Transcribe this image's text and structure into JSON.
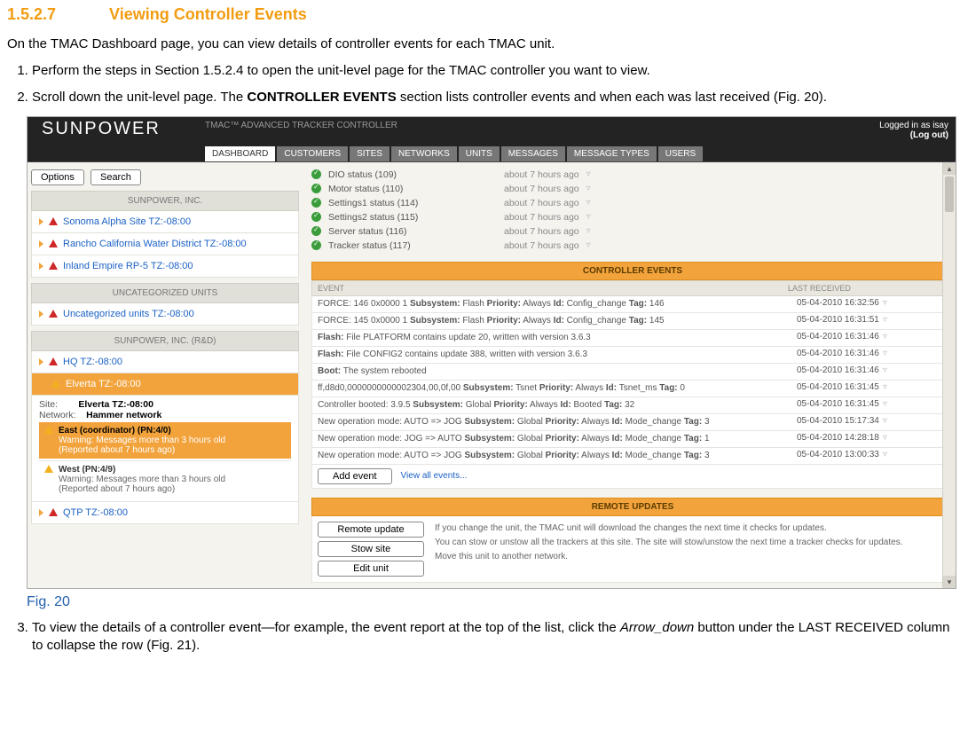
{
  "heading": {
    "num": "1.5.2.7",
    "title": "Viewing Controller Events"
  },
  "intro": "On the TMAC Dashboard page, you can view details of controller events for each TMAC unit.",
  "step1": "Perform the steps in Section 1.5.2.4 to open the unit-level page for the TMAC controller you want to view.",
  "step2_a": "Scroll down the unit-level page. The ",
  "step2_b": "CONTROLLER EVENTS",
  "step2_c": " section lists controller events and when each was last received (Fig. 20).",
  "fig_caption": "Fig. 20",
  "step3_a": "To view the details of a controller event—for example, the event report at the top of the list, click the ",
  "step3_i": "Arrow_down",
  "step3_b": " button under the LAST RECEIVED column to collapse the row (Fig. 21).",
  "logo": "SUNPOWER",
  "crumb": "TMAC™ ADVANCED TRACKER CONTROLLER",
  "login_as": "Logged in as isay",
  "logout": "(Log out)",
  "tabs": [
    "DASHBOARD",
    "CUSTOMERS",
    "SITES",
    "NETWORKS",
    "UNITS",
    "MESSAGES",
    "MESSAGE TYPES",
    "USERS"
  ],
  "side": {
    "options": "Options",
    "search": "Search",
    "grp1": "SUNPOWER, INC.",
    "items1": [
      "Sonoma Alpha Site TZ:-08:00",
      "Rancho California Water District TZ:-08:00",
      "Inland Empire RP-5 TZ:-08:00"
    ],
    "grp2": "UNCATEGORIZED UNITS",
    "items2": [
      "Uncategorized units TZ:-08:00"
    ],
    "grp3": "SUNPOWER, INC. (R&D)",
    "items3": [
      "HQ TZ:-08:00"
    ],
    "sel": "Elverta TZ:-08:00",
    "site_lbl": "Site:",
    "site_val": "Elverta TZ:-08:00",
    "net_lbl": "Network:",
    "net_val": "Hammer network",
    "east_title": "East (coordinator) (PN:4/0)",
    "east_warn1": "Warning: Messages more than 3 hours old",
    "east_warn2": "(Reported about 7 hours ago)",
    "west_title": "West (PN:4/9)",
    "west_warn1": "Warning: Messages more than 3 hours old",
    "west_warn2": "(Reported about 7 hours ago)",
    "qtp": "QTP TZ:-08:00"
  },
  "status": [
    {
      "label": "DIO status (109)",
      "ago": "about 7 hours ago"
    },
    {
      "label": "Motor status (110)",
      "ago": "about 7 hours ago"
    },
    {
      "label": "Settings1 status (114)",
      "ago": "about 7 hours ago"
    },
    {
      "label": "Settings2 status (115)",
      "ago": "about 7 hours ago"
    },
    {
      "label": "Server status (116)",
      "ago": "about 7 hours ago"
    },
    {
      "label": "Tracker status (117)",
      "ago": "about 7 hours ago"
    }
  ],
  "events_head": "CONTROLLER EVENTS",
  "ev_col1": "EVENT",
  "ev_col2": "LAST RECEIVED",
  "events": [
    {
      "t": "FORCE: 146 0x0000 1 <b>Subsystem:</b> Flash <b>Priority:</b> Always <b>Id:</b> Config_change <b>Tag:</b> 146",
      "d": "05-04-2010 16:32:56"
    },
    {
      "t": "FORCE: 145 0x0000 1 <b>Subsystem:</b> Flash <b>Priority:</b> Always <b>Id:</b> Config_change <b>Tag:</b> 145",
      "d": "05-04-2010 16:31:51"
    },
    {
      "t": "<b>Flash:</b> File PLATFORM contains update 20, written with version 3.6.3",
      "d": "05-04-2010 16:31:46"
    },
    {
      "t": "<b>Flash:</b> File CONFIG2 contains update 388, written with version 3.6.3",
      "d": "05-04-2010 16:31:46"
    },
    {
      "t": "<b>Boot:</b> The system rebooted",
      "d": "05-04-2010 16:31:46"
    },
    {
      "t": "ff,d8d0,0000000000002304,00,0f,00 <b>Subsystem:</b> Tsnet <b>Priority:</b> Always <b>Id:</b> Tsnet_ms <b>Tag:</b> 0",
      "d": "05-04-2010 16:31:45"
    },
    {
      "t": "Controller booted: 3.9.5 <b>Subsystem:</b> Global <b>Priority:</b> Always <b>Id:</b> Booted <b>Tag:</b> 32",
      "d": "05-04-2010 16:31:45"
    },
    {
      "t": "New operation mode: AUTO => JOG <b>Subsystem:</b> Global <b>Priority:</b> Always <b>Id:</b> Mode_change <b>Tag:</b> 3",
      "d": "05-04-2010 15:17:34"
    },
    {
      "t": "New operation mode: JOG => AUTO <b>Subsystem:</b> Global <b>Priority:</b> Always <b>Id:</b> Mode_change <b>Tag:</b> 1",
      "d": "05-04-2010 14:28:18"
    },
    {
      "t": "New operation mode: AUTO => JOG <b>Subsystem:</b> Global <b>Priority:</b> Always <b>Id:</b> Mode_change <b>Tag:</b> 3",
      "d": "05-04-2010 13:00:33"
    }
  ],
  "add_event": "Add event",
  "view_all": "View all events...",
  "updates_head": "REMOTE UPDATES",
  "btn_remote": "Remote update",
  "btn_stow": "Stow site",
  "btn_edit": "Edit unit",
  "upd_text1": "If you change the unit, the TMAC unit will download the changes the next time it checks for updates.",
  "upd_text2": "You can stow or unstow all the trackers at this site. The site will stow/unstow the next time a tracker checks for updates.",
  "upd_text3": "Move this unit to another network."
}
